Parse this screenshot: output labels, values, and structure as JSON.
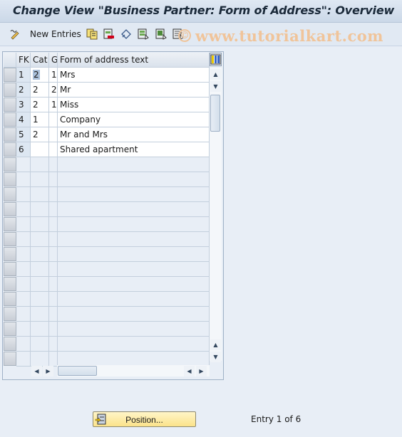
{
  "window": {
    "title": "Change View \"Business Partner: Form of Address\": Overview"
  },
  "toolbar": {
    "items": [
      {
        "icon": "display-change-icon"
      },
      {
        "label": "New Entries"
      },
      {
        "icon": "copy-as-icon"
      },
      {
        "icon": "delete-icon"
      },
      {
        "icon": "undo-change-icon"
      },
      {
        "icon": "select-all-icon"
      },
      {
        "icon": "select-block-icon"
      },
      {
        "icon": "deselect-all-icon"
      }
    ],
    "new_entries_label": "New Entries"
  },
  "watermark": {
    "text": "www.tutorialkart.com",
    "symbol": "©"
  },
  "table": {
    "columns": [
      "FK",
      "Cat",
      "G",
      "Form of address text"
    ],
    "rows": [
      {
        "fk": "1",
        "cat": "2",
        "g": "1",
        "text": "Mrs"
      },
      {
        "fk": "2",
        "cat": "2",
        "g": "2",
        "text": "Mr"
      },
      {
        "fk": "3",
        "cat": "2",
        "g": "1",
        "text": "Miss"
      },
      {
        "fk": "4",
        "cat": "1",
        "g": "",
        "text": "Company"
      },
      {
        "fk": "5",
        "cat": "2",
        "g": "",
        "text": "Mr and Mrs"
      },
      {
        "fk": "6",
        "cat": "",
        "g": "",
        "text": "Shared apartment"
      }
    ],
    "empty_rows": 14
  },
  "footer": {
    "position_button": "Position...",
    "entry_text": "Entry 1 of 6"
  }
}
